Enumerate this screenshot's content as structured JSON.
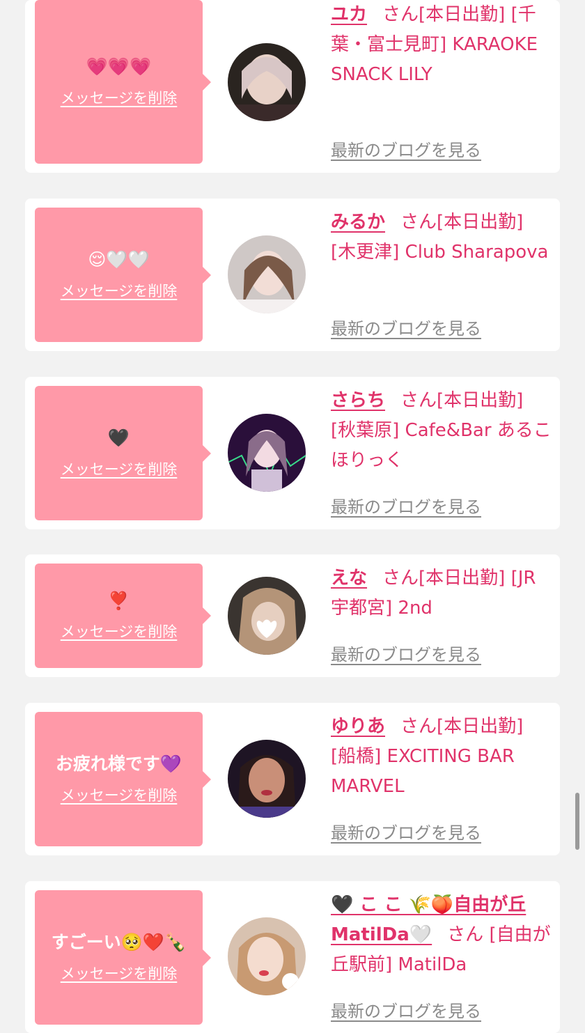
{
  "delete_label": "メッセージを削除",
  "blog_label": "最新のブログを見る",
  "san_label": "さん",
  "status_label": "[本日出勤]",
  "cards": [
    {
      "message": "💗💗💗",
      "name": "ユカ",
      "shop": "[千葉・富士見町] KARAOKE SNACK LILY"
    },
    {
      "message": "😌🤍🤍",
      "name": "みるか",
      "shop": "[木更津] Club Sharapova"
    },
    {
      "message": "🖤",
      "name": "さらち",
      "shop": "[秋葉原] Cafe&Bar あるこほりっく"
    },
    {
      "message": "❣️",
      "name": "えな",
      "shop": "[JR宇都宮] 2nd"
    },
    {
      "message": "お疲れ様です💜",
      "name": "ゆりあ",
      "shop": "[船橋] EXCITING BAR MARVEL"
    },
    {
      "message": "すごーい🥺❤️🍾",
      "name": "🖤 こ こ 🌾🍑自由が丘MatilDa🤍",
      "shop": "[自由が丘駅前] MatilDa"
    }
  ]
}
